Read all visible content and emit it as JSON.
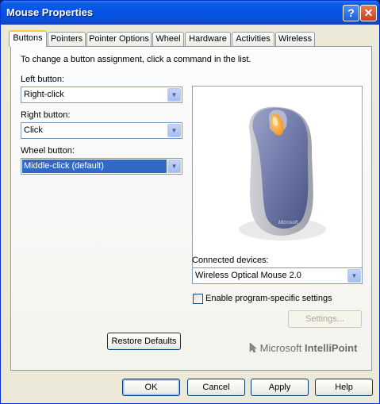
{
  "window": {
    "title": "Mouse Properties",
    "help_label": "?",
    "close_label": "✕"
  },
  "tabs": [
    "Buttons",
    "Pointers",
    "Pointer Options",
    "Wheel",
    "Hardware",
    "Activities",
    "Wireless"
  ],
  "active_tab": "Buttons",
  "buttons_tab": {
    "instruction": "To change a button assignment, click a command in the list.",
    "left_button": {
      "label": "Left button:",
      "value": "Right-click"
    },
    "right_button": {
      "label": "Right button:",
      "value": "Click"
    },
    "wheel_button": {
      "label": "Wheel button:",
      "value": "Middle-click (default)"
    },
    "connected_devices": {
      "label": "Connected devices:",
      "value": "Wireless Optical Mouse 2.0"
    },
    "program_specific_label": "Enable program-specific settings",
    "program_specific_checked": false,
    "settings_button": "Settings...",
    "restore_defaults_button": "Restore Defaults",
    "brand": {
      "prefix": "Microsoft",
      "product": "IntelliPoint"
    },
    "mouse_logo_text": "Microsoft"
  },
  "footer": {
    "ok": "OK",
    "cancel": "Cancel",
    "apply": "Apply",
    "help": "Help"
  },
  "icons": {
    "dropdown": "chevron-down-icon",
    "brand": "mouse-cursor-icon"
  }
}
